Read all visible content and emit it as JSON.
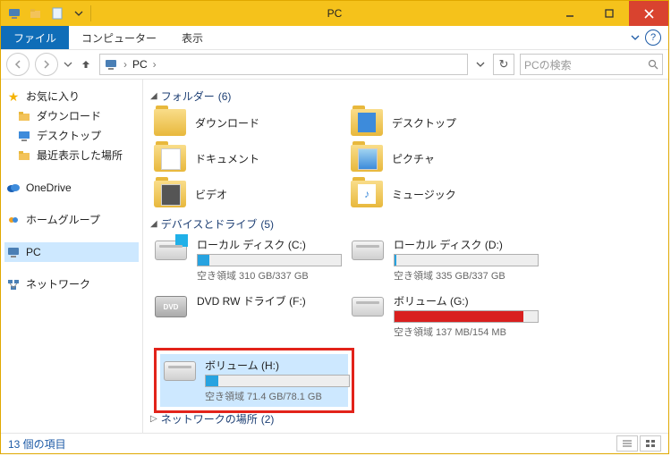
{
  "window": {
    "title": "PC"
  },
  "ribbon": {
    "file": "ファイル",
    "tabs": [
      "コンピューター",
      "表示"
    ]
  },
  "addressbar": {
    "location": "PC",
    "search_placeholder": "PCの検索"
  },
  "sidebar": {
    "favorites": {
      "label": "お気に入り",
      "items": [
        "ダウンロード",
        "デスクトップ",
        "最近表示した場所"
      ]
    },
    "onedrive": "OneDrive",
    "homegroup": "ホームグループ",
    "pc": "PC",
    "network": "ネットワーク"
  },
  "sections": {
    "folders": {
      "label": "フォルダー",
      "count": 6
    },
    "drives": {
      "label": "デバイスとドライブ",
      "count": 5
    },
    "network": {
      "label": "ネットワークの場所",
      "count": 2
    }
  },
  "folders": [
    {
      "label": "ダウンロード"
    },
    {
      "label": "デスクトップ"
    },
    {
      "label": "ドキュメント"
    },
    {
      "label": "ピクチャ"
    },
    {
      "label": "ビデオ"
    },
    {
      "label": "ミュージック"
    }
  ],
  "drives": {
    "c": {
      "name": "ローカル ディスク (C:)",
      "free_label": "空き領域 310 GB/337 GB",
      "used_pct": 8
    },
    "d": {
      "name": "ローカル ディスク (D:)",
      "free_label": "空き領域 335 GB/337 GB",
      "used_pct": 1
    },
    "f": {
      "name": "DVD RW ドライブ (F:)"
    },
    "g": {
      "name": "ボリューム (G:)",
      "free_label": "空き領域 137 MB/154 MB",
      "used_pct": 90
    },
    "h": {
      "name": "ボリューム (H:)",
      "free_label": "空き領域 71.4 GB/78.1 GB",
      "used_pct": 9
    }
  },
  "statusbar": {
    "count_label": "13 個の項目"
  }
}
